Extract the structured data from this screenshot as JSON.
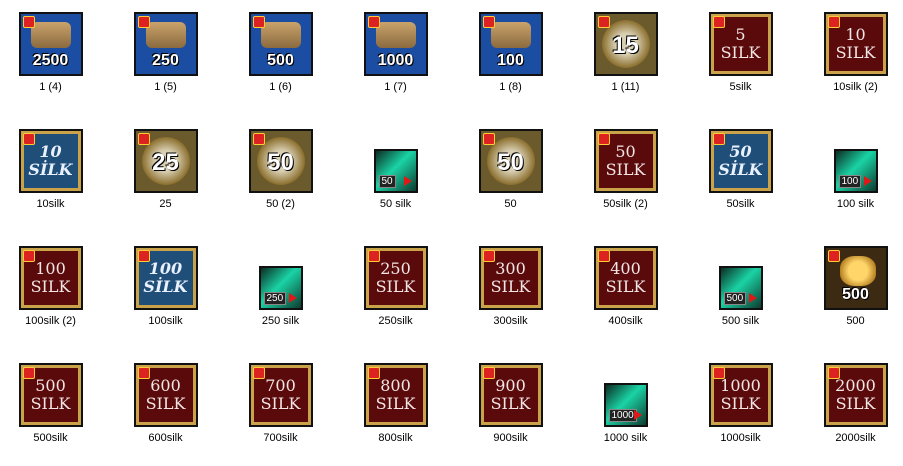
{
  "items": [
    {
      "caption": "1 (4)",
      "label": "2500",
      "bg": "#1b4ea3",
      "kind": "scroll"
    },
    {
      "caption": "1 (5)",
      "label": "250",
      "bg": "#1b4ea3",
      "kind": "scroll"
    },
    {
      "caption": "1 (6)",
      "label": "500",
      "bg": "#1b4ea3",
      "kind": "scroll"
    },
    {
      "caption": "1 (7)",
      "label": "1000",
      "bg": "#1b4ea3",
      "kind": "scroll"
    },
    {
      "caption": "1 (8)",
      "label": "100",
      "bg": "#1b4ea3",
      "kind": "scroll"
    },
    {
      "caption": "1 (11)",
      "label": "15",
      "bg": "#6b5a2c",
      "kind": "scroll-gold"
    },
    {
      "caption": "5silk",
      "label": "5\nSILK",
      "bg": "#5a0a0a",
      "kind": "silk-red"
    },
    {
      "caption": "10silk (2)",
      "label": "10\nSILK",
      "bg": "#5a0a0a",
      "kind": "silk-red"
    },
    {
      "caption": "10silk",
      "label": "10\nSİLK",
      "bg": "#1f4e79",
      "kind": "silk-blue"
    },
    {
      "caption": "25",
      "label": "25",
      "bg": "#6b5a2c",
      "kind": "scroll-gold"
    },
    {
      "caption": "50 (2)",
      "label": "50",
      "bg": "#6b5a2c",
      "kind": "scroll-gold"
    },
    {
      "caption": "50 silk",
      "label": "50",
      "bg": "#0b2d23",
      "kind": "ticket"
    },
    {
      "caption": "50",
      "label": "50",
      "bg": "#6b5a2c",
      "kind": "scroll-gold"
    },
    {
      "caption": "50silk (2)",
      "label": "50\nSILK",
      "bg": "#5a0a0a",
      "kind": "silk-red"
    },
    {
      "caption": "50silk",
      "label": "50\nSİLK",
      "bg": "#1f4e79",
      "kind": "silk-blue"
    },
    {
      "caption": "100 silk",
      "label": "100",
      "bg": "#0b2d23",
      "kind": "ticket"
    },
    {
      "caption": "100silk (2)",
      "label": "100\nSILK",
      "bg": "#5a0a0a",
      "kind": "silk-red"
    },
    {
      "caption": "100silk",
      "label": "100\nSİLK",
      "bg": "#1f4e79",
      "kind": "silk-blue"
    },
    {
      "caption": "250 silk",
      "label": "250",
      "bg": "#0b2d23",
      "kind": "ticket"
    },
    {
      "caption": "250silk",
      "label": "250\nSILK",
      "bg": "#5a0a0a",
      "kind": "silk-red"
    },
    {
      "caption": "300silk",
      "label": "300\nSILK",
      "bg": "#5a0a0a",
      "kind": "silk-red"
    },
    {
      "caption": "400silk",
      "label": "400\nSILK",
      "bg": "#5a0a0a",
      "kind": "silk-red"
    },
    {
      "caption": "500 silk",
      "label": "500",
      "bg": "#0b2d23",
      "kind": "ticket"
    },
    {
      "caption": "500",
      "label": "500",
      "bg": "#3d2a12",
      "kind": "coins"
    },
    {
      "caption": "500silk",
      "label": "500\nSILK",
      "bg": "#5a0a0a",
      "kind": "silk-red"
    },
    {
      "caption": "600silk",
      "label": "600\nSILK",
      "bg": "#5a0a0a",
      "kind": "silk-red"
    },
    {
      "caption": "700silk",
      "label": "700\nSILK",
      "bg": "#5a0a0a",
      "kind": "silk-red"
    },
    {
      "caption": "800silk",
      "label": "800\nSILK",
      "bg": "#5a0a0a",
      "kind": "silk-red"
    },
    {
      "caption": "900silk",
      "label": "900\nSILK",
      "bg": "#5a0a0a",
      "kind": "silk-red"
    },
    {
      "caption": "1000 silk",
      "label": "1000",
      "bg": "#0b2d23",
      "kind": "ticket"
    },
    {
      "caption": "1000silk",
      "label": "1000\nSILK",
      "bg": "#5a0a0a",
      "kind": "silk-red"
    },
    {
      "caption": "2000silk",
      "label": "2000\nSILK",
      "bg": "#5a0a0a",
      "kind": "silk-red"
    }
  ]
}
